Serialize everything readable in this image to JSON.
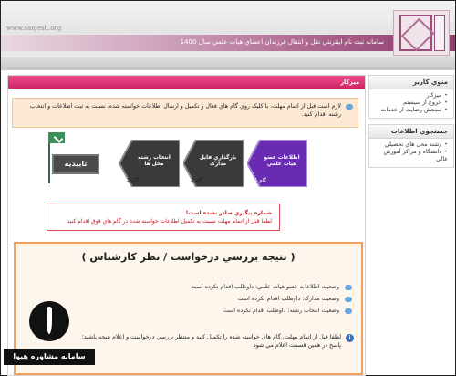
{
  "header": {
    "site_url": "www.sanjesh.org",
    "title": "سامانه ثبت نام اينترنتي نقل و انتقال فرزندان اعضاي هيات علمي سال 1400"
  },
  "sidebar": {
    "menu_title": "منوي کاربر",
    "menu_items": [
      {
        "label": "ميزکار"
      },
      {
        "label": "خروج از سيستم"
      },
      {
        "label": "سنجش رضايت از خدمات"
      }
    ],
    "info_title": "جستجوي اطلاعات",
    "info_items": [
      {
        "label": "رشته محل هاي تحصيلي"
      },
      {
        "label": "دانشگاه و مراکز آموزش عالي"
      }
    ]
  },
  "main": {
    "panel_title": "ميزکار",
    "notice": "لازم است قبل از اتمام مهلت، با کليک روي گام هاي فعال و تکميل و ارسال اطلاعات خواسته شده، نسبت به ثبت اطلاعات و انتخاب رشته اقدام کنيد.",
    "steps": [
      {
        "label": "اطلاعات عضو هيات علمي",
        "step": "گام 1",
        "color": "#6a2bb3"
      },
      {
        "label": "بارگذاري فايل مدارک",
        "step": "گام 2",
        "color": "#3a3a3a"
      },
      {
        "label": "انتخاب رشته محل ها",
        "step": "گام 3",
        "color": "#3a3a3a"
      }
    ],
    "final_label": "تاييديه",
    "tracking_warning": "شماره پيگيري صادر نشده است!",
    "deadline_warning": "لطفا قبل از اتمام مهلت نسبت به تکميل اطلاعات خواسته شده در گام هاي فوق اقدام کنيد",
    "result_title": "( نتيجه بررسي درخواست / نظر کارشناس )",
    "result_items": [
      {
        "label": "وضعيت اطلاعات عضو هيات علمي: داوطلب اقدام نکرده است"
      },
      {
        "label": "وضعيت مدارک: داوطلب اقدام نکرده است"
      },
      {
        "label": "وضعيت انتخاب رشته: داوطلب اقدام نکرده است"
      }
    ],
    "result_note": "لطفا قبل از اتمام مهلت، گام هاي خواسته شده را تکميل کنيد و منتظر بررسي درخواست و اعلام نتيجه باشيد؛ پاسخ در همين قسمت اعلام مي شود"
  },
  "watermark": {
    "text": "سامانه مشاوره هيوا"
  }
}
